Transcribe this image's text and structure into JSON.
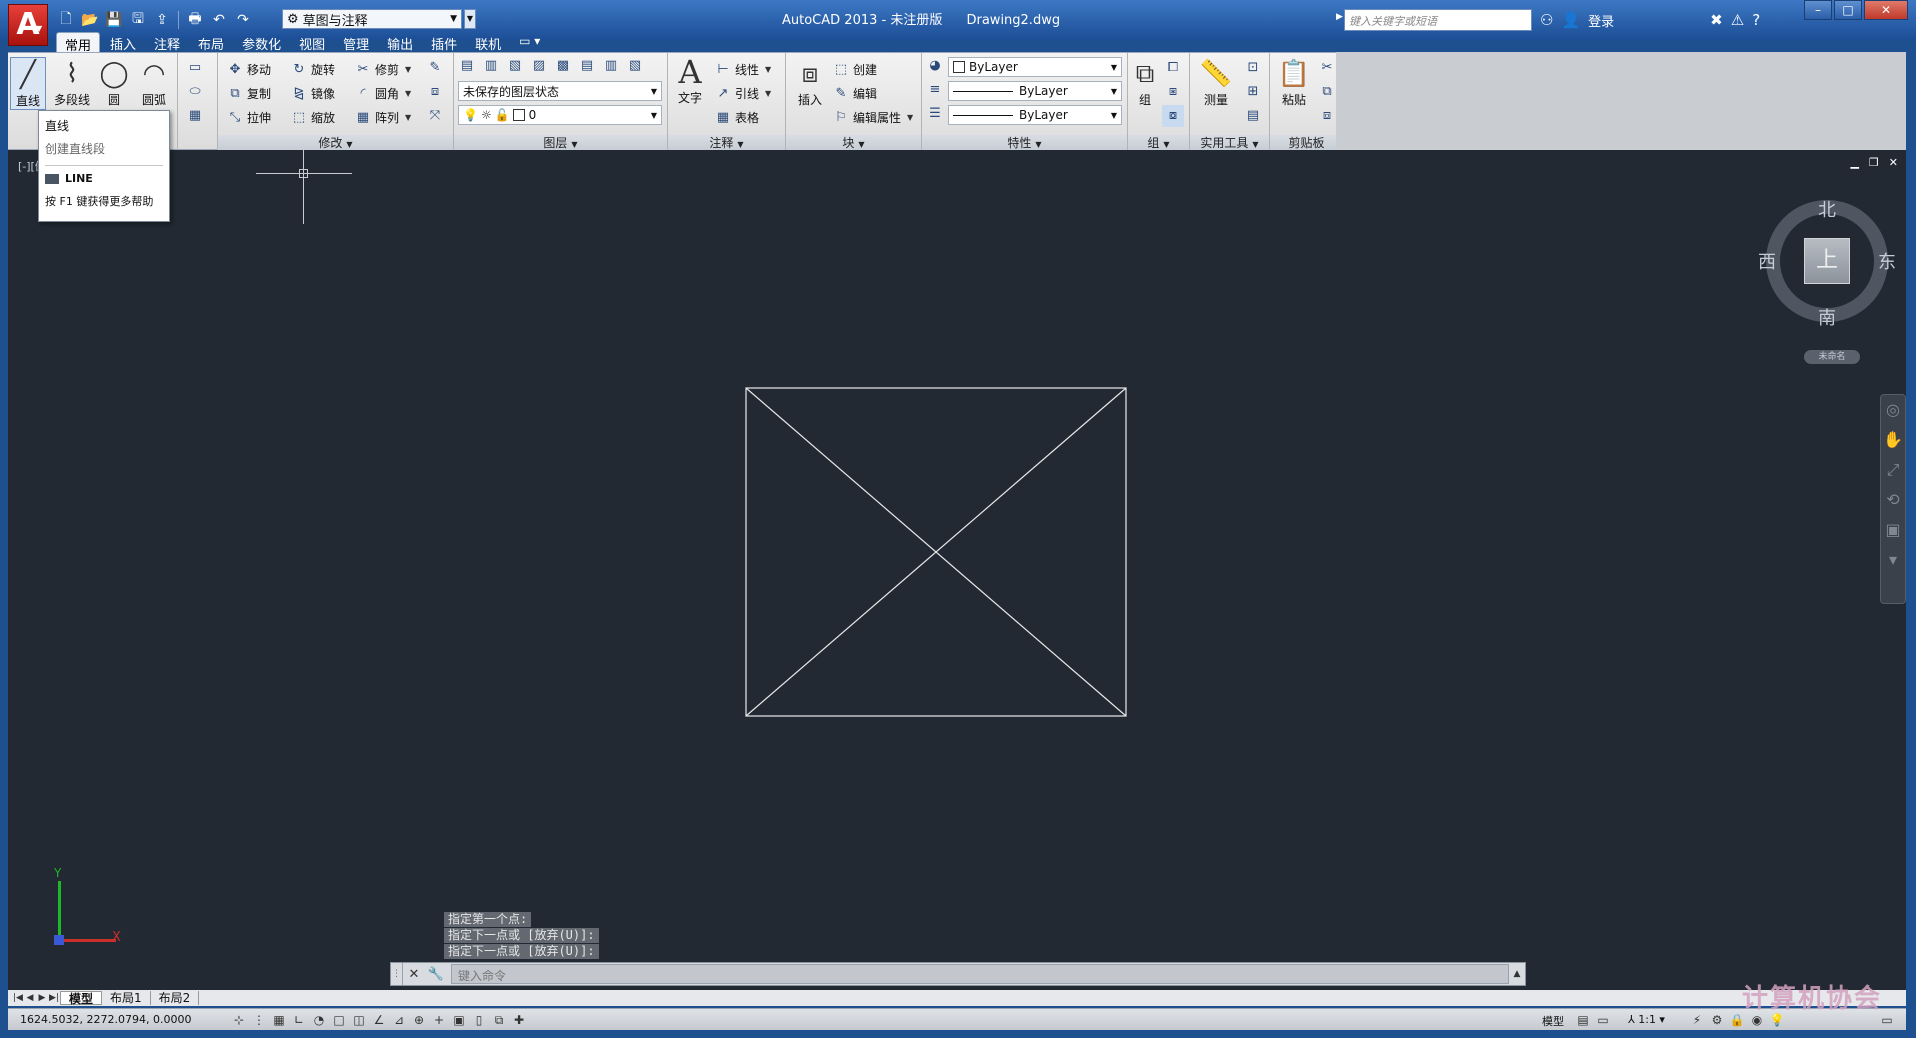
{
  "titlebar": {
    "app_logo": "A",
    "workspace": "草图与注释",
    "app_name": "AutoCAD 2013 - 未注册版",
    "document": "Drawing2.dwg",
    "search_placeholder": "键入关键字或短语",
    "login": "登录"
  },
  "ribbon_tabs": [
    "常用",
    "插入",
    "注释",
    "布局",
    "参数化",
    "视图",
    "管理",
    "输出",
    "插件",
    "联机"
  ],
  "panels": {
    "draw": {
      "line": "直线",
      "polyline": "多段线",
      "circle": "圆",
      "arc": "圆弧"
    },
    "modify": {
      "title": "修改",
      "move": "移动",
      "rotate": "旋转",
      "trim": "修剪",
      "copy": "复制",
      "mirror": "镜像",
      "fillet": "圆角",
      "stretch": "拉伸",
      "scale": "缩放",
      "array": "阵列"
    },
    "layers": {
      "title": "图层",
      "layer_state": "未保存的图层状态",
      "current_layer": "0"
    },
    "annotation": {
      "title": "注释",
      "text": "文字",
      "linear": "线性",
      "leader": "引线",
      "table": "表格"
    },
    "block": {
      "title": "块",
      "insert": "插入",
      "create": "创建",
      "edit": "编辑",
      "edit_attributes": "编辑属性"
    },
    "properties": {
      "title": "特性",
      "color": "ByLayer",
      "linetype": "ByLayer",
      "lineweight": "ByLayer"
    },
    "groups": {
      "title": "组",
      "group": "组"
    },
    "utilities": {
      "title": "实用工具",
      "measure": "测量"
    },
    "clipboard": {
      "title": "剪贴板",
      "paste": "粘贴"
    }
  },
  "tooltip": {
    "title": "直线",
    "description": "创建直线段",
    "command": "LINE",
    "help": "按 F1 键获得更多帮助"
  },
  "viewport": {
    "label": "[-][俯视][二维线框]"
  },
  "viewcube": {
    "north": "北",
    "south": "南",
    "east": "东",
    "west": "西",
    "face": "上",
    "ucs_name": "未命名"
  },
  "ucs": {
    "x": "X",
    "y": "Y"
  },
  "command_history": [
    "指定第一个点:",
    "指定下一点或 [放弃(U)]:",
    "指定下一点或 [放弃(U)]:"
  ],
  "command_input_placeholder": "键入命令",
  "layout_tabs": [
    "模型",
    "布局1",
    "布局2"
  ],
  "status": {
    "coordinates": "1624.5032,  2272.0794,  0.0000",
    "model": "模型",
    "scale": "1:1"
  },
  "watermark": "计算机协会",
  "colors": {
    "canvas": "#222933",
    "titlebar": "#2a5ea8",
    "ucs_x": "#c9302c",
    "ucs_y": "#1db82a",
    "logo": "#d9271f"
  }
}
